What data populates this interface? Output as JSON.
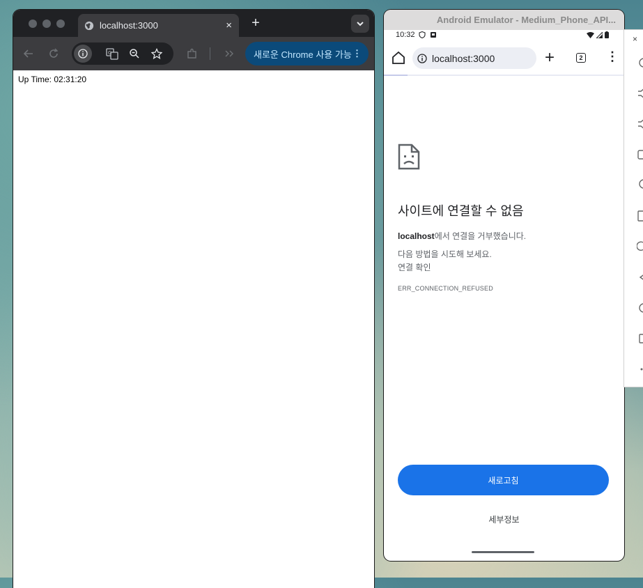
{
  "desktop_chrome": {
    "tab": {
      "title": "localhost:3000",
      "close_icon": "×"
    },
    "new_tab_icon": "+",
    "tab_search_icon": "chevron-down-icon",
    "upgrade_chip": {
      "label": "새로운 Chrome 사용 가능",
      "menu_icon": "⋮"
    },
    "page": {
      "uptime": "Up Time: 02:31:20"
    }
  },
  "emulator": {
    "window_title": "Android Emulator - Medium_Phone_API...",
    "status_bar": {
      "time": "10:32"
    },
    "browser": {
      "url": "localhost:3000",
      "plus": "+",
      "tab_count": "2",
      "menu": "⋮"
    },
    "error": {
      "title": "사이트에 연결할 수 없음",
      "host": "localhost",
      "refused_suffix": "에서 연결을 거부했습니다.",
      "try_line": "다음 방법을 시도해 보세요.",
      "check_line": "연결 확인",
      "code": "ERR_CONNECTION_REFUSED",
      "reload_label": "새로고침",
      "details_label": "세부정보"
    },
    "side_panel": {
      "close": "×"
    }
  }
}
